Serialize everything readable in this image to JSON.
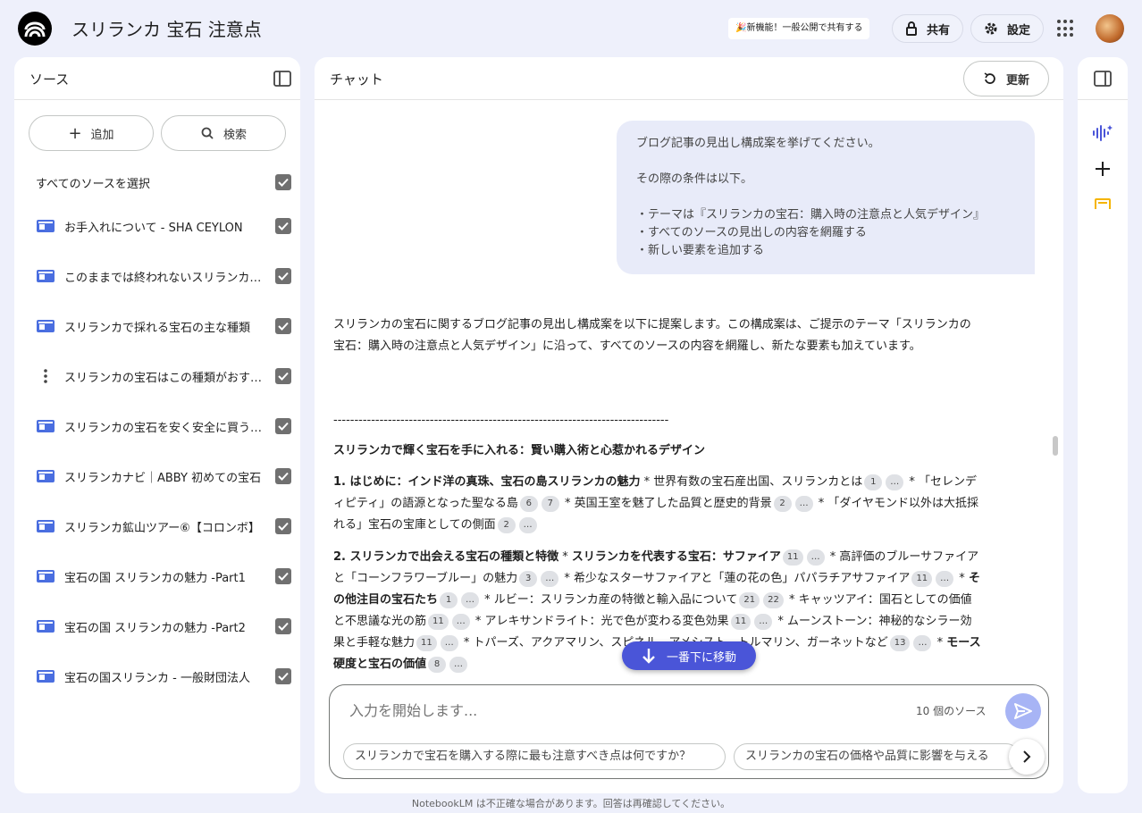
{
  "app": {
    "title": "スリランカ 宝石 注意点",
    "new_feature": "🎉新機能！一般公開で共有する",
    "share_label": "共有",
    "settings_label": "設定"
  },
  "sources_panel": {
    "title": "ソース",
    "add_label": "追加",
    "search_label": "検索",
    "select_all_label": "すべてのソースを選択",
    "items": [
      {
        "label": "お手入れについて - SHA CEYLON",
        "icon": "doc-icon"
      },
      {
        "label": "このままでは終われないスリランカ宝石",
        "icon": "doc-icon"
      },
      {
        "label": "スリランカで採れる宝石の主な種類",
        "icon": "doc-icon"
      },
      {
        "label": "スリランカの宝石はこの種類がおすすめ",
        "icon": "more-vert-icon"
      },
      {
        "label": "スリランカの宝石を安く安全に買う方法",
        "icon": "doc-icon"
      },
      {
        "label": "スリランカナビ｜ABBY 初めての宝石",
        "icon": "doc-icon"
      },
      {
        "label": "スリランカ鉱山ツアー⑥【コロンボ】",
        "icon": "doc-icon"
      },
      {
        "label": "宝石の国 スリランカの魅力 -Part1",
        "icon": "doc-icon"
      },
      {
        "label": "宝石の国 スリランカの魅力 -Part2",
        "icon": "doc-icon"
      },
      {
        "label": "宝石の国スリランカ - 一般財団法人",
        "icon": "doc-icon"
      }
    ]
  },
  "chat": {
    "title": "チャット",
    "refresh_label": "更新",
    "user_message": [
      "ブログ記事の見出し構成案を挙げてください。",
      "",
      "その際の条件は以下。",
      "",
      "・テーマは『スリランカの宝石：購入時の注意点と人気デザイン』",
      "・すべてのソースの見出しの内容を網羅する",
      "・新しい要素を追加する"
    ],
    "intro": "スリランカの宝石に関するブログ記事の見出し構成案を以下に提案します。この構成案は、ご提示のテーマ「スリランカの宝石：購入時の注意点と人気デザイン」に沿って、すべてのソースの内容を網羅し、新たな要素も加えています。",
    "divider": "--------------------------------------------------------------------------------",
    "headline": "スリランカで輝く宝石を手に入れる：賢い購入術と心惹かれるデザイン",
    "scroll_bottom_label": "一番下に移動",
    "input_placeholder": "入力を開始します...",
    "source_count": "10 個のソース",
    "suggestions": [
      "スリランカで宝石を購入する際に最も注意すべき点は何ですか？",
      "スリランカの宝石の価格や品質に影響を与える"
    ]
  },
  "footer": "NotebookLM は不正確な場合があります。回答は再確認してください。",
  "colors": {
    "accent": "#4a55d8",
    "source_icon": "#4a6ee0",
    "note_icon": "#f5b400"
  }
}
